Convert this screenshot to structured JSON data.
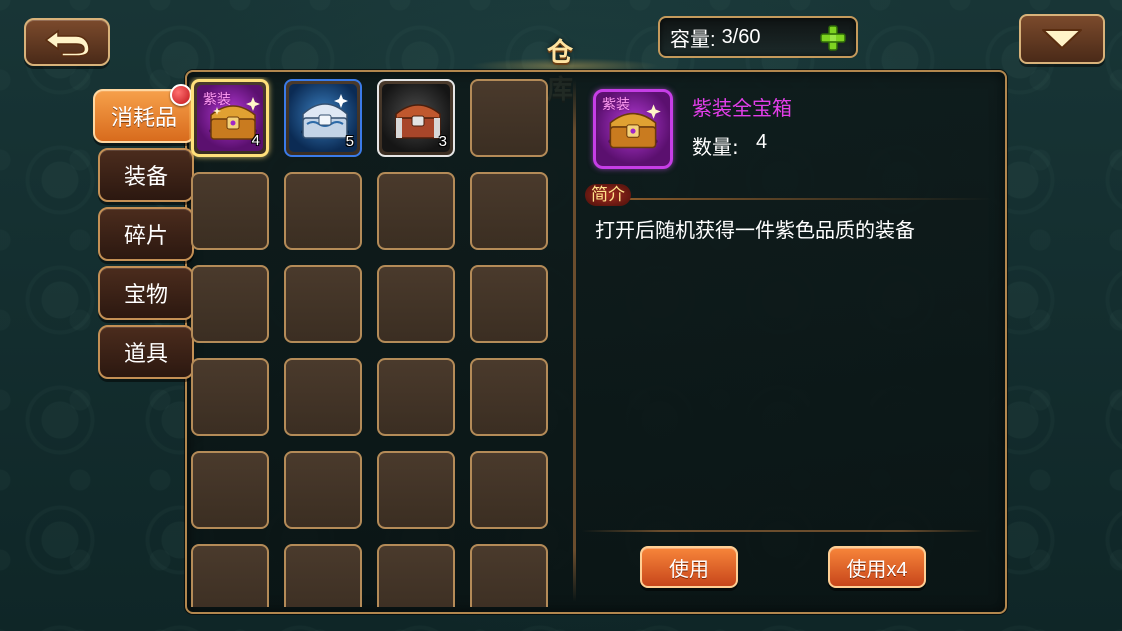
{
  "header": {
    "title": "仓 库",
    "capacity_label": "容量:",
    "capacity_value": "3/60"
  },
  "tabs": [
    {
      "label": "消耗品",
      "active": true
    },
    {
      "label": "装备"
    },
    {
      "label": "碎片"
    },
    {
      "label": "宝物"
    },
    {
      "label": "道具"
    }
  ],
  "inventory": {
    "items": [
      {
        "name": "紫装全宝箱",
        "quality": "purple",
        "tag": "紫装",
        "quantity": "4",
        "selected": true
      },
      {
        "name": "silver-chest",
        "quality": "blue",
        "quantity": "5"
      },
      {
        "name": "bronze-chest",
        "quality": "white",
        "quantity": "3"
      }
    ]
  },
  "detail": {
    "name": "紫装全宝箱",
    "name_color": "#e23ee9",
    "icon_tag": "紫装",
    "quantity_label": "数量:",
    "quantity_value": "4",
    "intro_label": "简介",
    "description": "打开后随机获得一件紫色品质的装备",
    "use_label": "使用",
    "use_all_label": "使用x4"
  },
  "colors": {
    "accent_orange": "#e8722a",
    "frame_gold": "#b48b58",
    "purple_quality": "#c63ee6",
    "blue_quality": "#3b7be8"
  },
  "icons": [
    "back-arrow-icon",
    "plus-icon",
    "dropdown-arrow-icon",
    "chest-icon"
  ]
}
